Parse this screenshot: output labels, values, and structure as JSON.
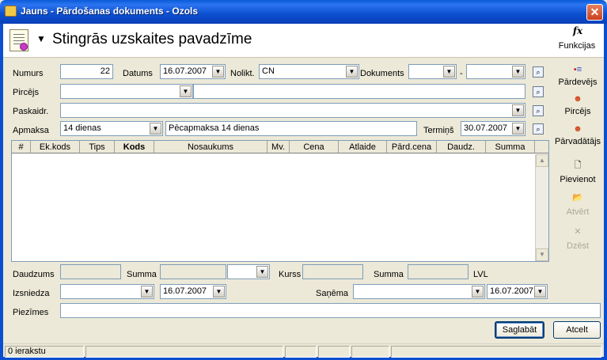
{
  "window": {
    "title": "Jauns - Pārdošanas dokuments - Ozols",
    "close_glyph": "✕"
  },
  "header": {
    "title": "Stingrās uzskaites pavadzīme",
    "caret": "▼",
    "functions_label": "Funkcijas",
    "fx_glyph": "fx"
  },
  "form": {
    "numurs": {
      "label": "Numurs",
      "value": "22"
    },
    "datums": {
      "label": "Datums",
      "value": "16.07.2007"
    },
    "noliktava": {
      "label": "Nolikt.",
      "value": "CN"
    },
    "dokuments": {
      "label": "Dokuments",
      "value1": "",
      "separator": "-",
      "value2": ""
    },
    "pircejs": {
      "label": "Pircējs",
      "value": "",
      "name": ""
    },
    "paskaidr": {
      "label": "Paskaidr.",
      "value": ""
    },
    "apmaksa": {
      "label": "Apmaksa",
      "value": "14 dienas",
      "description": "Pēcapmaksa 14 dienas"
    },
    "termins": {
      "label": "Termiņš",
      "value": "30.07.2007"
    }
  },
  "grid": {
    "columns": [
      "#",
      "Ek.kods",
      "Tips",
      "Kods",
      "Nosaukums",
      "Mv.",
      "Cena",
      "Atlaide",
      "Pārd.cena",
      "Daudz.",
      "Summa"
    ],
    "rows": []
  },
  "side": {
    "pardevejs": "Pārdevējs",
    "pircejs": "Pircējs",
    "parvadatajs": "Pārvadātājs",
    "pievienot": "Pievienot",
    "atvert": "Atvērt",
    "dzest": "Dzēst"
  },
  "totals": {
    "daudzums_label": "Daudzums",
    "summa_label": "Summa",
    "kurss_label": "Kurss",
    "summa2_label": "Summa",
    "currency": "LVL",
    "daudzums": "",
    "summa": "",
    "valuta": "",
    "kurss": "",
    "summa2": ""
  },
  "issue": {
    "izsniedza_label": "Izsniedza",
    "izsniedza_value": "",
    "izsniedza_date": "16.07.2007",
    "sanema_label": "Saņēma",
    "sanema_value": "",
    "sanema_date": "16.07.2007"
  },
  "notes": {
    "label": "Piezīmes",
    "value": ""
  },
  "buttons": {
    "save": "Saglabāt",
    "cancel": "Atcelt"
  },
  "status": {
    "records": "0 ierakstu"
  },
  "icons": {
    "lookup": "search-icon",
    "dropdown": "chevron-down-icon",
    "dropdown_glyph": "▼",
    "scroll_up_glyph": "▲",
    "scroll_down_glyph": "▼",
    "pievienot_glyph": "🗋",
    "atvert_glyph": "📂",
    "dzest_glyph": "✕"
  }
}
